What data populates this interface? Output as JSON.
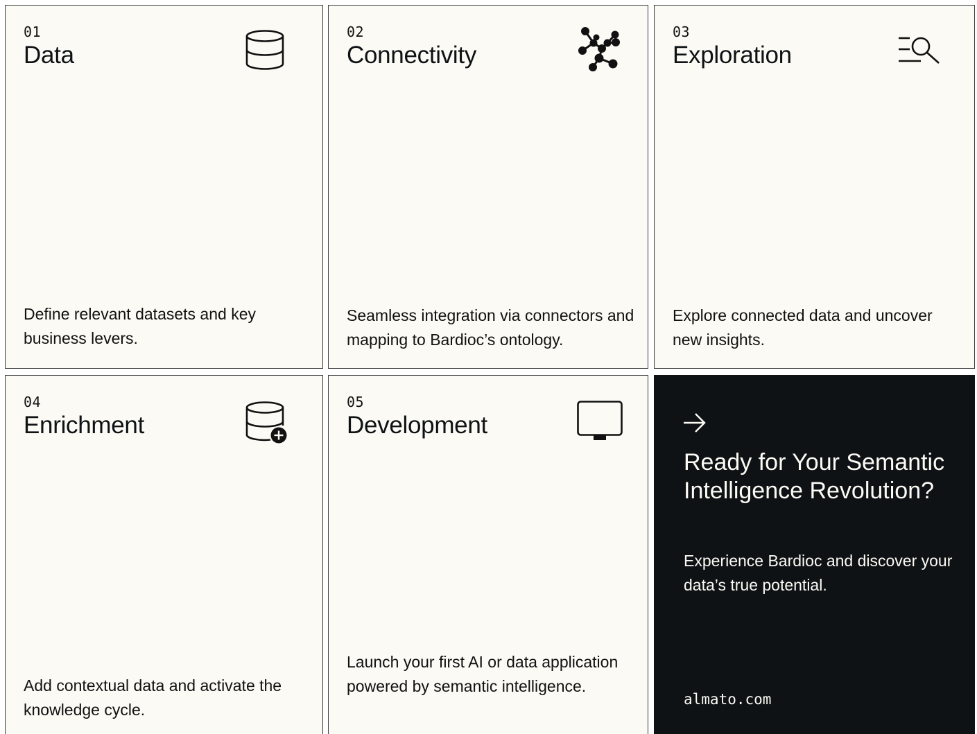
{
  "cards": [
    {
      "number": "01",
      "title": "Data",
      "description": "Define relevant datasets and key business levers.",
      "icon": "database-icon"
    },
    {
      "number": "02",
      "title": "Connectivity",
      "description": "Seamless integration via connectors and mapping to Bardioc’s ontology.",
      "icon": "network-nodes-icon"
    },
    {
      "number": "03",
      "title": "Exploration",
      "description": "Explore connected data and uncover new insights.",
      "icon": "search-list-icon"
    },
    {
      "number": "04",
      "title": "Enrichment",
      "description": "Add contextual data and activate the knowledge cycle.",
      "icon": "database-add-icon"
    },
    {
      "number": "05",
      "title": "Development",
      "description": "Launch your first AI or data application powered by semantic intelligence.",
      "icon": "monitor-icon"
    }
  ],
  "cta": {
    "icon": "arrow-right-icon",
    "title": "Ready for Your Semantic Intelligence Revolution?",
    "description": "Experience Bardioc and discover your data’s true potential.",
    "link": "almato.com"
  },
  "colors": {
    "card_background": "#fbfaf4",
    "cta_background": "#0f1215",
    "border": "#3a3a3a",
    "text": "#0f1215"
  }
}
